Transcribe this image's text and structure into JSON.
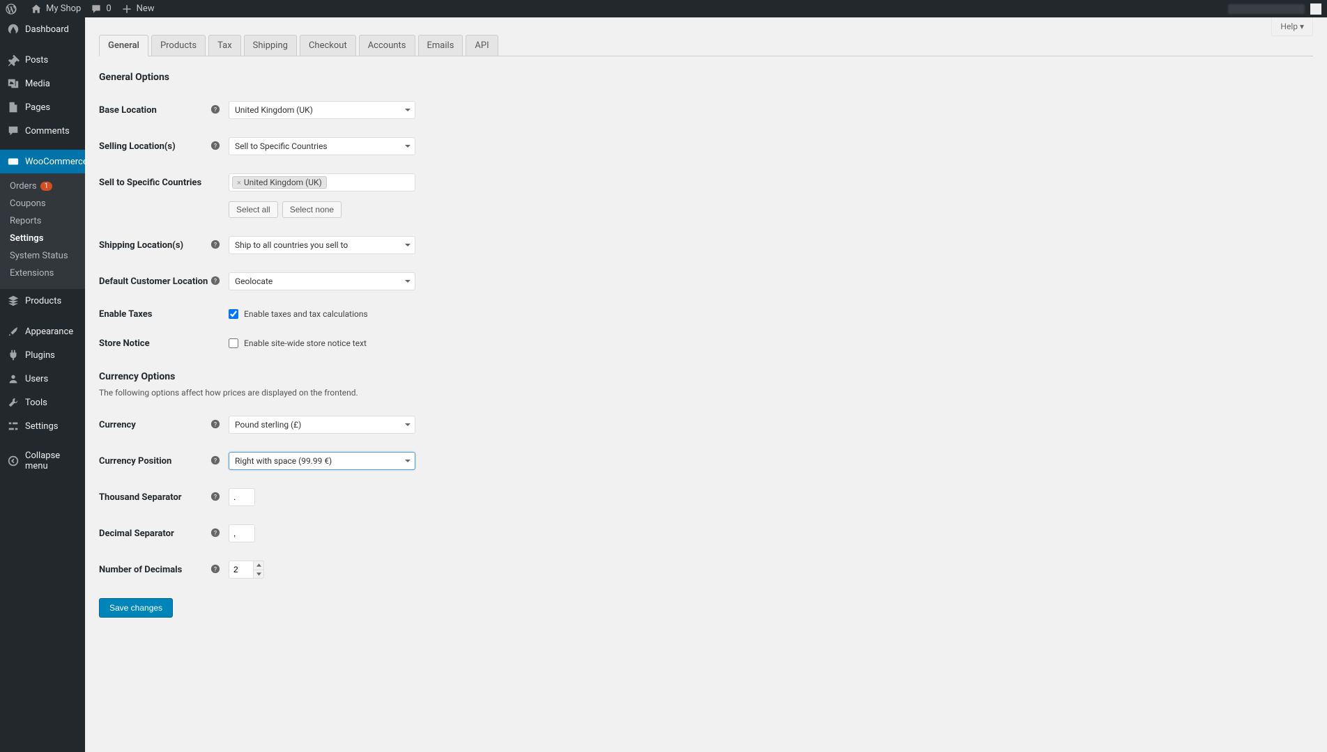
{
  "adminbar": {
    "site_name": "My Shop",
    "comments_count": "0",
    "new_label": "New"
  },
  "help_label": "Help ▾",
  "sidebar": {
    "dashboard": "Dashboard",
    "posts": "Posts",
    "media": "Media",
    "pages": "Pages",
    "comments": "Comments",
    "woocommerce": "WooCommerce",
    "wc_sub": {
      "orders": "Orders",
      "orders_badge": "1",
      "coupons": "Coupons",
      "reports": "Reports",
      "settings": "Settings",
      "system_status": "System Status",
      "extensions": "Extensions"
    },
    "products": "Products",
    "appearance": "Appearance",
    "plugins": "Plugins",
    "users": "Users",
    "tools": "Tools",
    "settings": "Settings",
    "collapse": "Collapse menu"
  },
  "tabs": {
    "general": "General",
    "products": "Products",
    "tax": "Tax",
    "shipping": "Shipping",
    "checkout": "Checkout",
    "accounts": "Accounts",
    "emails": "Emails",
    "api": "API"
  },
  "section1_title": "General Options",
  "fields": {
    "base_location_label": "Base Location",
    "base_location_value": "United Kingdom (UK)",
    "selling_locations_label": "Selling Location(s)",
    "selling_locations_value": "Sell to Specific Countries",
    "sell_specific_label": "Sell to Specific Countries",
    "sell_specific_chip": "United Kingdom (UK)",
    "select_all": "Select all",
    "select_none": "Select none",
    "shipping_locations_label": "Shipping Location(s)",
    "shipping_locations_value": "Ship to all countries you sell to",
    "default_customer_label": "Default Customer Location",
    "default_customer_value": "Geolocate",
    "enable_taxes_label": "Enable Taxes",
    "enable_taxes_cb": "Enable taxes and tax calculations",
    "store_notice_label": "Store Notice",
    "store_notice_cb": "Enable site-wide store notice text"
  },
  "section2_title": "Currency Options",
  "section2_desc": "The following options affect how prices are displayed on the frontend.",
  "currency_fields": {
    "currency_label": "Currency",
    "currency_value": "Pound sterling (£)",
    "currency_position_label": "Currency Position",
    "currency_position_value": "Right with space (99.99 €)",
    "thousand_sep_label": "Thousand Separator",
    "thousand_sep_value": ".",
    "decimal_sep_label": "Decimal Separator",
    "decimal_sep_value": ",",
    "num_decimals_label": "Number of Decimals",
    "num_decimals_value": "2"
  },
  "save_label": "Save changes"
}
